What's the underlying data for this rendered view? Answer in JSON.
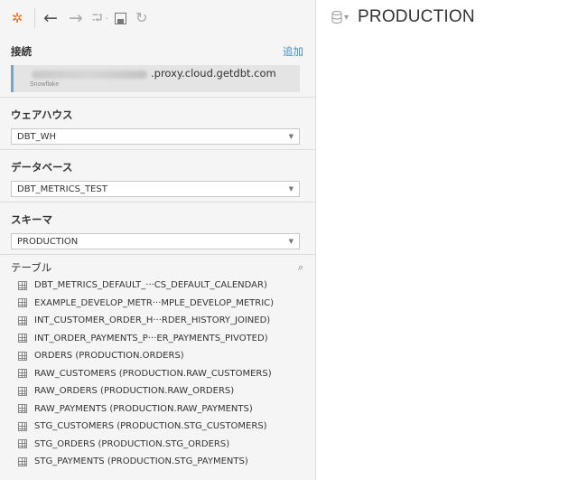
{
  "toolbar": {
    "icons": [
      "tableau-logo-icon",
      "back-arrow-icon",
      "forward-arrow-icon",
      "redo-icon",
      "save-icon",
      "refresh-icon"
    ]
  },
  "connections": {
    "title": "接続",
    "add_label": "追加",
    "host_suffix": ".proxy.cloud.getdbt.com",
    "type": "Snowflake"
  },
  "warehouse": {
    "title": "ウェアハウス",
    "value": "DBT_WH"
  },
  "database": {
    "title": "データベース",
    "value": "DBT_METRICS_TEST"
  },
  "schema": {
    "title": "スキーマ",
    "value": "PRODUCTION"
  },
  "tables": {
    "title": "テーブル",
    "items": [
      "DBT_METRICS_DEFAULT_···CS_DEFAULT_CALENDAR)",
      "EXAMPLE_DEVELOP_METR···MPLE_DEVELOP_METRIC)",
      "INT_CUSTOMER_ORDER_H···RDER_HISTORY_JOINED)",
      "INT_ORDER_PAYMENTS_P···ER_PAYMENTS_PIVOTED)",
      "ORDERS (PRODUCTION.ORDERS)",
      "RAW_CUSTOMERS (PRODUCTION.RAW_CUSTOMERS)",
      "RAW_ORDERS (PRODUCTION.RAW_ORDERS)",
      "RAW_PAYMENTS (PRODUCTION.RAW_PAYMENTS)",
      "STG_CUSTOMERS (PRODUCTION.STG_CUSTOMERS)",
      "STG_ORDERS (PRODUCTION.STG_ORDERS)",
      "STG_PAYMENTS (PRODUCTION.STG_PAYMENTS)"
    ]
  },
  "canvas": {
    "schema_title": "PRODUCTION"
  },
  "colors": {
    "accent_link": "#3d8fc6",
    "logo": "#e8762d",
    "connection_bar": "#7aa3c4"
  }
}
